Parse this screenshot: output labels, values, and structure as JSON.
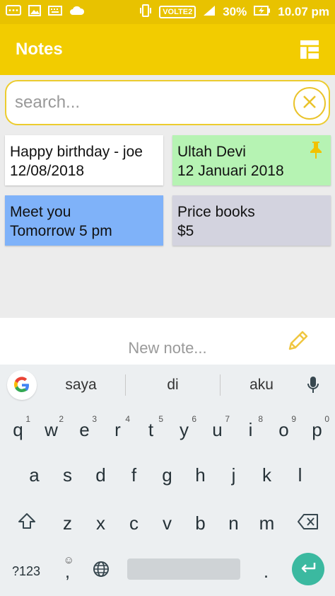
{
  "status_bar": {
    "volte": "VOLTE2",
    "battery": "30%",
    "time": "10.07 pm"
  },
  "app_bar": {
    "title": "Notes"
  },
  "search": {
    "placeholder": "search..."
  },
  "notes": [
    {
      "line1": "Happy birthday - joe",
      "line2": "12/08/2018",
      "color": "#ffffff",
      "pinned": false
    },
    {
      "line1": "Ultah Devi",
      "line2": "12 Januari 2018",
      "color": "#b6f3b3",
      "pinned": true
    },
    {
      "line1": "Meet you",
      "line2": "Tomorrow 5 pm",
      "color": "#7fb2f9",
      "pinned": false
    },
    {
      "line1": "Price books",
      "line2": "$5",
      "color": "#d3d3df",
      "pinned": false
    }
  ],
  "new_note": {
    "placeholder": "New note..."
  },
  "keyboard": {
    "suggestions": [
      "saya",
      "di",
      "aku"
    ],
    "row1": [
      {
        "k": "q",
        "n": "1"
      },
      {
        "k": "w",
        "n": "2"
      },
      {
        "k": "e",
        "n": "3"
      },
      {
        "k": "r",
        "n": "4"
      },
      {
        "k": "t",
        "n": "5"
      },
      {
        "k": "y",
        "n": "6"
      },
      {
        "k": "u",
        "n": "7"
      },
      {
        "k": "i",
        "n": "8"
      },
      {
        "k": "o",
        "n": "9"
      },
      {
        "k": "p",
        "n": "0"
      }
    ],
    "row2": [
      "a",
      "s",
      "d",
      "f",
      "g",
      "h",
      "j",
      "k",
      "l"
    ],
    "row3": [
      "z",
      "x",
      "c",
      "v",
      "b",
      "n",
      "m"
    ],
    "symbols_label": "?123",
    "comma": ",",
    "period": ".",
    "emoji_glyph": "☺"
  },
  "colors": {
    "status_bar": "#e8c200",
    "app_bar": "#f2cc00",
    "accent": "#eac32a",
    "enter": "#3bb9a0"
  }
}
